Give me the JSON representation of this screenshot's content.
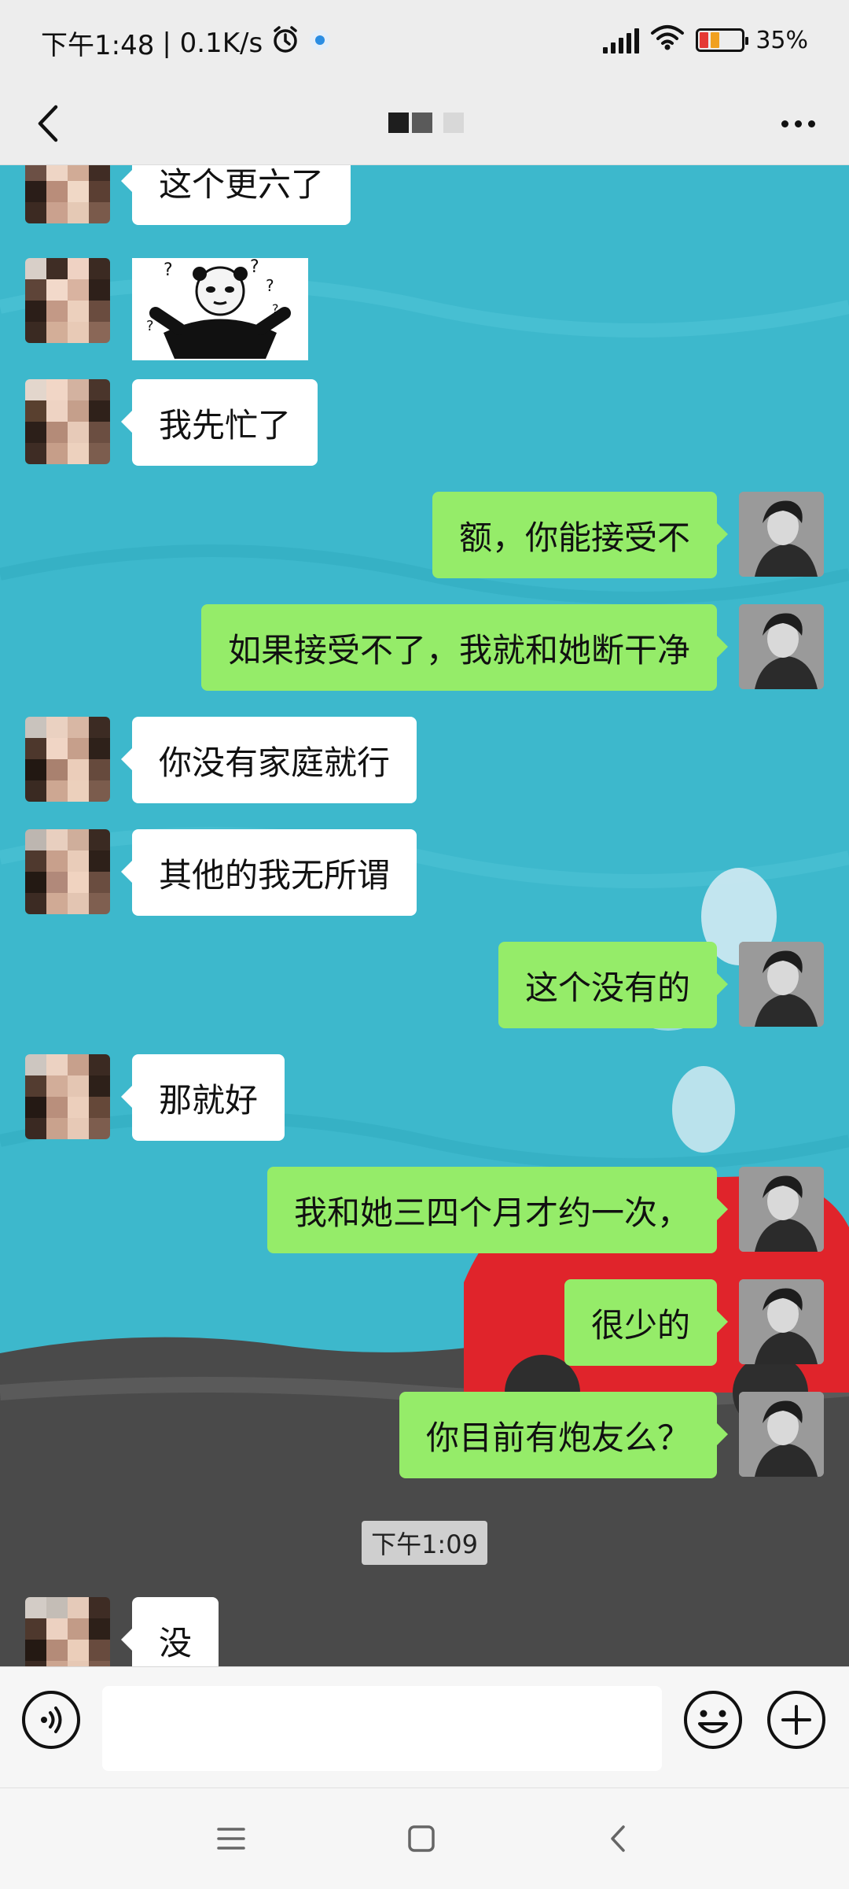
{
  "status_bar": {
    "time": "下午1:48",
    "net_speed": "| 0.1K/s",
    "battery": "35%",
    "icons": [
      "alarm-icon",
      "app-badge-icon",
      "signal-icon",
      "wifi-icon",
      "battery-icon"
    ]
  },
  "header": {
    "title": "",
    "icons": [
      "back-icon",
      "more-icon"
    ]
  },
  "messages": [
    {
      "side": "left",
      "text": "这个更六了"
    },
    {
      "side": "left",
      "type": "sticker",
      "text": ""
    },
    {
      "side": "left",
      "text": "我先忙了"
    },
    {
      "side": "right",
      "text": "额，你能接受不"
    },
    {
      "side": "right",
      "text": "如果接受不了，我就和她断干净"
    },
    {
      "side": "left",
      "text": "你没有家庭就行"
    },
    {
      "side": "left",
      "text": "其他的我无所谓"
    },
    {
      "side": "right",
      "text": "这个没有的"
    },
    {
      "side": "left",
      "text": "那就好"
    },
    {
      "side": "right",
      "text": "我和她三四个月才约一次，"
    },
    {
      "side": "right",
      "text": "很少的"
    },
    {
      "side": "right",
      "text": "你目前有炮友么？"
    },
    {
      "side": "left",
      "text": "没"
    }
  ],
  "timestamp": "下午1:09",
  "input_bar": {
    "value": "",
    "icons": [
      "voice-icon",
      "emoji-icon",
      "plus-icon"
    ]
  },
  "nav_bar": {
    "icons": [
      "menu-icon",
      "home-icon",
      "back-nav-icon"
    ]
  },
  "colors": {
    "chat_background": "#3db8cc",
    "self_bubble": "#95ec69",
    "other_bubble": "#ffffff",
    "bar_background": "#ededed"
  }
}
